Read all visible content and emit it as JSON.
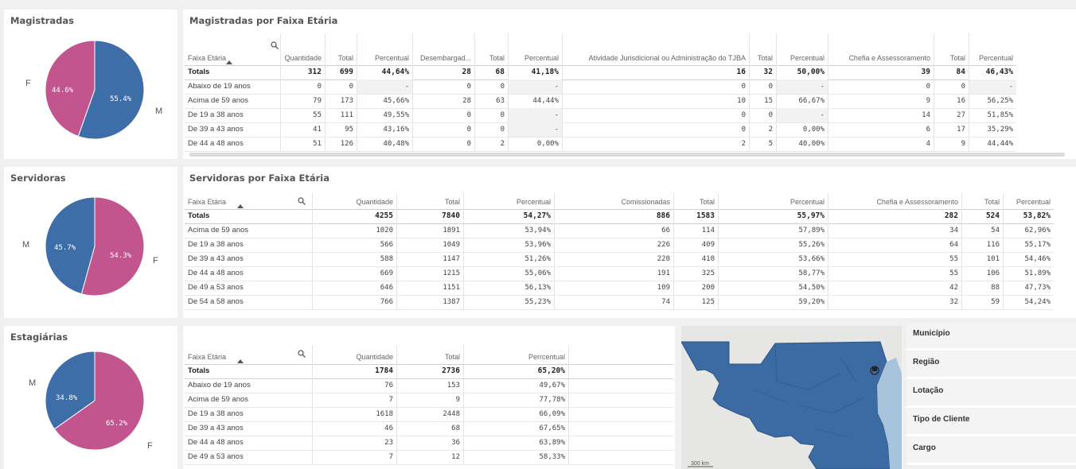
{
  "colors": {
    "female": "#c2558d",
    "male": "#3e6ea7",
    "map_land": "#3c6aa3",
    "map_bg": "#e6e7e4"
  },
  "magistradas": {
    "title": "Magistradas",
    "pie": {
      "F": 44.6,
      "M": 55.4,
      "label_f": "44.6%",
      "label_m": "55.4%",
      "side_f": "F",
      "side_m": "M"
    }
  },
  "servidoras": {
    "title": "Servidoras",
    "pie": {
      "F": 54.3,
      "M": 45.7,
      "label_f": "54.3%",
      "label_m": "45.7%",
      "side_f": "F",
      "side_m": "M"
    }
  },
  "estagiarias": {
    "title": "Estagiárias",
    "pie": {
      "F": 65.2,
      "M": 34.8,
      "label_f": "65.2%",
      "label_m": "34.8%",
      "side_f": "F",
      "side_m": "M"
    }
  },
  "table_mag": {
    "title": "Magistradas por Faixa Etária",
    "headers": [
      "Faixa Etária",
      "Quantidade",
      "Total",
      "Percentual",
      "Desembargad...",
      "Total",
      "Percentual",
      "Atividade Jurisdicional ou Administração do TJBA",
      "Total",
      "Percentual",
      "Chefia e Assessoramento",
      "Total",
      "Percentual"
    ],
    "totals": [
      "Totals",
      "312",
      "699",
      "44,64%",
      "28",
      "68",
      "41,18%",
      "16",
      "32",
      "50,00%",
      "39",
      "84",
      "46,43%"
    ],
    "rows": [
      [
        "Abaixo de 19 anos",
        "0",
        "0",
        "-",
        "0",
        "0",
        "-",
        "0",
        "0",
        "-",
        "0",
        "0",
        "-"
      ],
      [
        "Acima de 59 anos",
        "79",
        "173",
        "45,66%",
        "28",
        "63",
        "44,44%",
        "10",
        "15",
        "66,67%",
        "9",
        "16",
        "56,25%"
      ],
      [
        "De 19 a 38 anos",
        "55",
        "111",
        "49,55%",
        "0",
        "0",
        "-",
        "0",
        "0",
        "-",
        "14",
        "27",
        "51,85%"
      ],
      [
        "De 39 a 43 anos",
        "41",
        "95",
        "43,16%",
        "0",
        "0",
        "-",
        "0",
        "2",
        "0,00%",
        "6",
        "17",
        "35,29%"
      ],
      [
        "De 44 a 48 anos",
        "51",
        "126",
        "40,48%",
        "0",
        "2",
        "0,00%",
        "2",
        "5",
        "40,00%",
        "4",
        "9",
        "44,44%"
      ]
    ]
  },
  "table_serv": {
    "title": "Servidoras por Faixa Etária",
    "headers": [
      "Faixa Etária",
      "Quantidade",
      "Total",
      "Percentual",
      "Comissionadas",
      "Total",
      "Percentual",
      "Chefia e Assessoramento",
      "Total",
      "Percentual"
    ],
    "totals": [
      "Totals",
      "4255",
      "7840",
      "54,27%",
      "886",
      "1583",
      "55,97%",
      "282",
      "524",
      "53,82%"
    ],
    "rows": [
      [
        "Acima de 59 anos",
        "1020",
        "1891",
        "53,94%",
        "66",
        "114",
        "57,89%",
        "34",
        "54",
        "62,96%"
      ],
      [
        "De 19 a 38 anos",
        "566",
        "1049",
        "53,96%",
        "226",
        "409",
        "55,26%",
        "64",
        "116",
        "55,17%"
      ],
      [
        "De 39 a 43 anos",
        "588",
        "1147",
        "51,26%",
        "220",
        "410",
        "53,66%",
        "55",
        "101",
        "54,46%"
      ],
      [
        "De 44 a 48 anos",
        "669",
        "1215",
        "55,06%",
        "191",
        "325",
        "58,77%",
        "55",
        "106",
        "51,89%"
      ],
      [
        "De 49 a 53 anos",
        "646",
        "1151",
        "56,13%",
        "109",
        "200",
        "54,50%",
        "42",
        "88",
        "47,73%"
      ],
      [
        "De 54 a 58 anos",
        "766",
        "1387",
        "55,23%",
        "74",
        "125",
        "59,20%",
        "32",
        "59",
        "54,24%"
      ]
    ]
  },
  "table_est": {
    "headers": [
      "Faixa Etária",
      "Quantidade",
      "Total",
      "Perrcentual"
    ],
    "totals": [
      "Totals",
      "1784",
      "2736",
      "65,20%"
    ],
    "rows": [
      [
        "Abaixo de 19 anos",
        "76",
        "153",
        "49,67%"
      ],
      [
        "Acima de 59 anos",
        "7",
        "9",
        "77,78%"
      ],
      [
        "De 19 a 38 anos",
        "1618",
        "2448",
        "66,09%"
      ],
      [
        "De 39 a 43 anos",
        "46",
        "68",
        "67,65%"
      ],
      [
        "De 44 a 48 anos",
        "23",
        "36",
        "63,89%"
      ],
      [
        "De 49 a 53 anos",
        "7",
        "12",
        "58,33%"
      ]
    ]
  },
  "filters": [
    "Município",
    "Região",
    "Lotação",
    "Tipo de Cliente",
    "Cargo"
  ],
  "map": {
    "scale_label": "300 km"
  }
}
